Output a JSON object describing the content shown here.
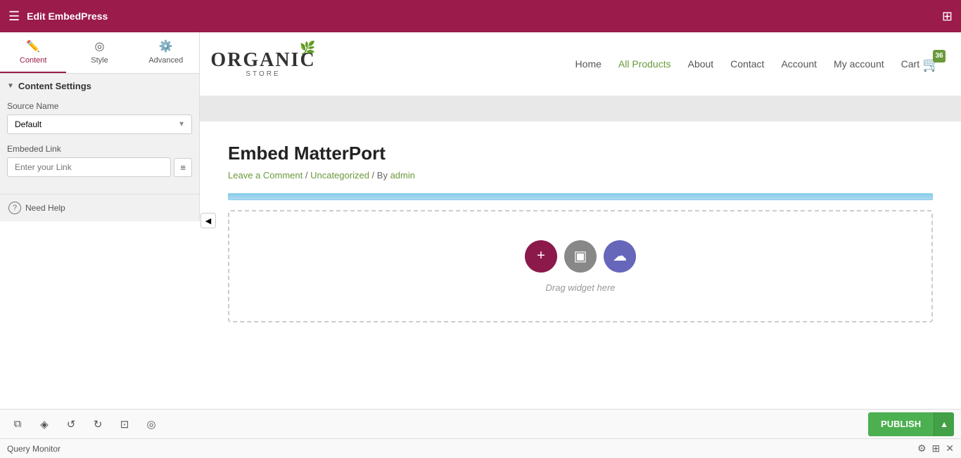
{
  "topbar": {
    "title": "Edit EmbedPress",
    "hamburger_icon": "☰",
    "grid_icon": "⊞"
  },
  "sidebar": {
    "tabs": [
      {
        "id": "content",
        "label": "Content",
        "icon": "✏️",
        "active": true
      },
      {
        "id": "style",
        "label": "Style",
        "icon": "◎",
        "active": false
      },
      {
        "id": "advanced",
        "label": "Advanced",
        "icon": "⚙️",
        "active": false
      }
    ],
    "section": {
      "label": "Content Settings",
      "arrow": "▼"
    },
    "fields": {
      "source_name": {
        "label": "Source Name",
        "value": "Default",
        "options": [
          "Default"
        ]
      },
      "embed_link": {
        "label": "Embeded Link",
        "placeholder": "Enter your Link"
      }
    },
    "need_help": "Need Help",
    "collapse_arrow": "◀"
  },
  "site": {
    "logo": {
      "main": "ORGANIC",
      "sub": "STORE",
      "leaf": "🌿"
    },
    "nav": [
      {
        "label": "Home",
        "active": false
      },
      {
        "label": "All Products",
        "active": true
      },
      {
        "label": "About",
        "active": false
      },
      {
        "label": "Contact",
        "active": false
      },
      {
        "label": "Account",
        "active": false
      },
      {
        "label": "My account",
        "active": false
      },
      {
        "label": "Cart",
        "active": false
      }
    ],
    "cart_count": "36"
  },
  "page": {
    "title": "Embed MatterPort",
    "meta_link": "Leave a Comment",
    "meta_sep1": " / ",
    "meta_category": "Uncategorized",
    "meta_sep2": " / By ",
    "meta_author": "admin"
  },
  "drop_zone": {
    "label": "Drag widget here",
    "buttons": [
      {
        "icon": "+",
        "type": "plus"
      },
      {
        "icon": "▣",
        "type": "folder"
      },
      {
        "icon": "☁",
        "type": "cloud"
      }
    ]
  },
  "bottom_toolbar": {
    "icons_left": [
      {
        "name": "layers",
        "icon": "⧉"
      },
      {
        "name": "add-widget",
        "icon": "◈"
      },
      {
        "name": "undo",
        "icon": "↺"
      },
      {
        "name": "redo",
        "icon": "↻"
      },
      {
        "name": "preview",
        "icon": "⊡"
      },
      {
        "name": "eye",
        "icon": "◎"
      }
    ],
    "publish_label": "PUBLISH",
    "publish_arrow": "▲"
  },
  "query_monitor": {
    "label": "Query Monitor",
    "icons": [
      "⚙",
      "⊞",
      "✕"
    ]
  }
}
